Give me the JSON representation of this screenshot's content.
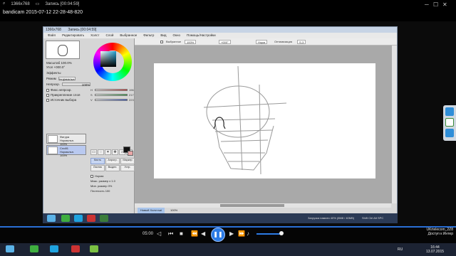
{
  "player": {
    "resolution": "1366x768",
    "recording_label": "Запись [00:04:59]",
    "filename": "bandicam 2015-07-12 22-28-48-820",
    "time": "05:00"
  },
  "sai": {
    "title": "1366x768",
    "title_extra": "Запись [00:04:59]",
    "menu": [
      "Файл",
      "Редактировать",
      "Холст",
      "Слой",
      "Выбранное",
      "Фильтр",
      "Вид",
      "Окно",
      "Помощь/Настройки"
    ],
    "toolbar": {
      "select_label": "Выбранное",
      "zoom": "100%",
      "angle": "+000°",
      "mode": "Норм",
      "stabilizer_label": "Оптимизация",
      "stabilizer_value": "S-3",
      "version_text": "SAI Ver.1.1.0"
    },
    "nav": {
      "zoom_label": "Масштаб",
      "zoom_value": "100.0%",
      "angle_label": "Угол",
      "angle_value": "+000.0°"
    },
    "layer_panel": {
      "effects_label": "Эффекты",
      "blend_label": "Режим",
      "blend_value": "Нормальн.",
      "opacity_label": "Непрозр.",
      "opacity_value": "100%",
      "options": [
        "Фикс.непрозр.",
        "Прикрепление слоя",
        "Источник выбора"
      ]
    },
    "color_sliders": [
      {
        "label": "H",
        "value": "196",
        "color": "#d23a3a"
      },
      {
        "label": "S",
        "value": "217",
        "color": "#3aa44a"
      },
      {
        "label": "V",
        "value": "223",
        "color": "#3a5bd2"
      }
    ],
    "layers": [
      {
        "name": "Фигура",
        "mode": "Нормальн.",
        "opacity": "100%"
      },
      {
        "name": "Слой1",
        "mode": "Нормальн.",
        "opacity": "100%"
      }
    ],
    "tools": [
      "Кисть",
      "Аэрогр.",
      "Маркер",
      "Ластик",
      "Выдел.",
      "Устр."
    ],
    "tool_options": {
      "mode_label": "Норма",
      "size_label": "Макс. размер",
      "size_value": "x 1.0",
      "min_size_label": "Мин. размер",
      "min_size_value": "0%",
      "density_label": "Плотность",
      "density_value": "100"
    },
    "status": {
      "file": "Новый Холст.sai",
      "zoom": "100%",
      "memory": "Загрузка памяти 40% (8M8 / 40MB)",
      "keys": "Shift Ctrl Alt SPC"
    }
  },
  "host": {
    "tray_line1": "UKrtelecom_2Z8",
    "tray_line2": "Доступ к Интер",
    "time": "16:44",
    "date": "13.07.2015",
    "lang": "RU"
  },
  "colors": {
    "accent": "#2c7be5",
    "sai_bg": "#d8d8d8",
    "canvas_bg": "#ffffff"
  }
}
